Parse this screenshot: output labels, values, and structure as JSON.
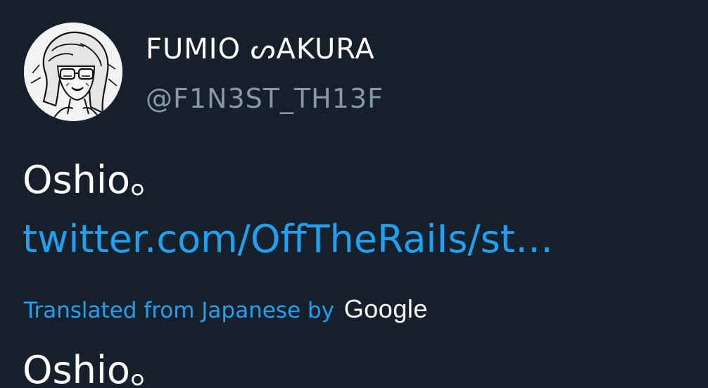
{
  "user": {
    "display_name": "FUMIO ᔕAKURA",
    "handle": "@F1N3ST_TH13F",
    "avatar_icon": "anime-portrait-avatar"
  },
  "tweet": {
    "text": "Oshio。",
    "link_text": "twitter.com/OffTheRaiIs/st…"
  },
  "translation": {
    "label": "Translated from Japanese by",
    "provider": "Google",
    "text": "Oshio。"
  },
  "colors": {
    "background": "#15202b",
    "link": "#1da1f2",
    "secondary_text": "#8899a6",
    "primary_text": "#ffffff"
  }
}
